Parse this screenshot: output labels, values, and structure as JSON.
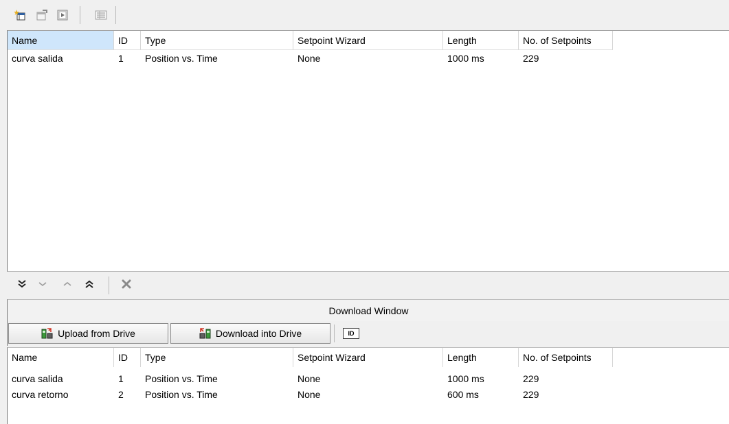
{
  "top_toolbar": {
    "icons": [
      "new-table-icon",
      "edit-table-icon",
      "export-icon",
      "properties-icon"
    ]
  },
  "top_table": {
    "columns": [
      "Name",
      "ID",
      "Type",
      "Setpoint Wizard",
      "Length",
      "No. of Setpoints"
    ],
    "rows": [
      [
        "curva salida",
        "1",
        "Position vs. Time",
        "None",
        "1000 ms",
        "229"
      ]
    ]
  },
  "mid_toolbar": {
    "icons": [
      "move-to-bottom-icon",
      "move-down-icon",
      "move-up-icon",
      "move-to-top-icon",
      "delete-icon"
    ]
  },
  "download_window": {
    "title": "Download Window",
    "upload_label": "Upload from Drive",
    "download_label": "Download into Drive",
    "id_label": "ID",
    "columns": [
      "Name",
      "ID",
      "Type",
      "Setpoint Wizard",
      "Length",
      "No. of Setpoints"
    ],
    "rows": [
      [
        "curva salida",
        "1",
        "Position vs. Time",
        "None",
        "1000 ms",
        "229"
      ],
      [
        "curva retorno",
        "2",
        "Position vs. Time",
        "None",
        "600 ms",
        "229"
      ]
    ]
  },
  "colors": {
    "header_selected": "#cfe6fb",
    "toolbar_bg": "#f0f0f0",
    "accent_red": "#d03a2a",
    "accent_green": "#3a9a3a"
  }
}
